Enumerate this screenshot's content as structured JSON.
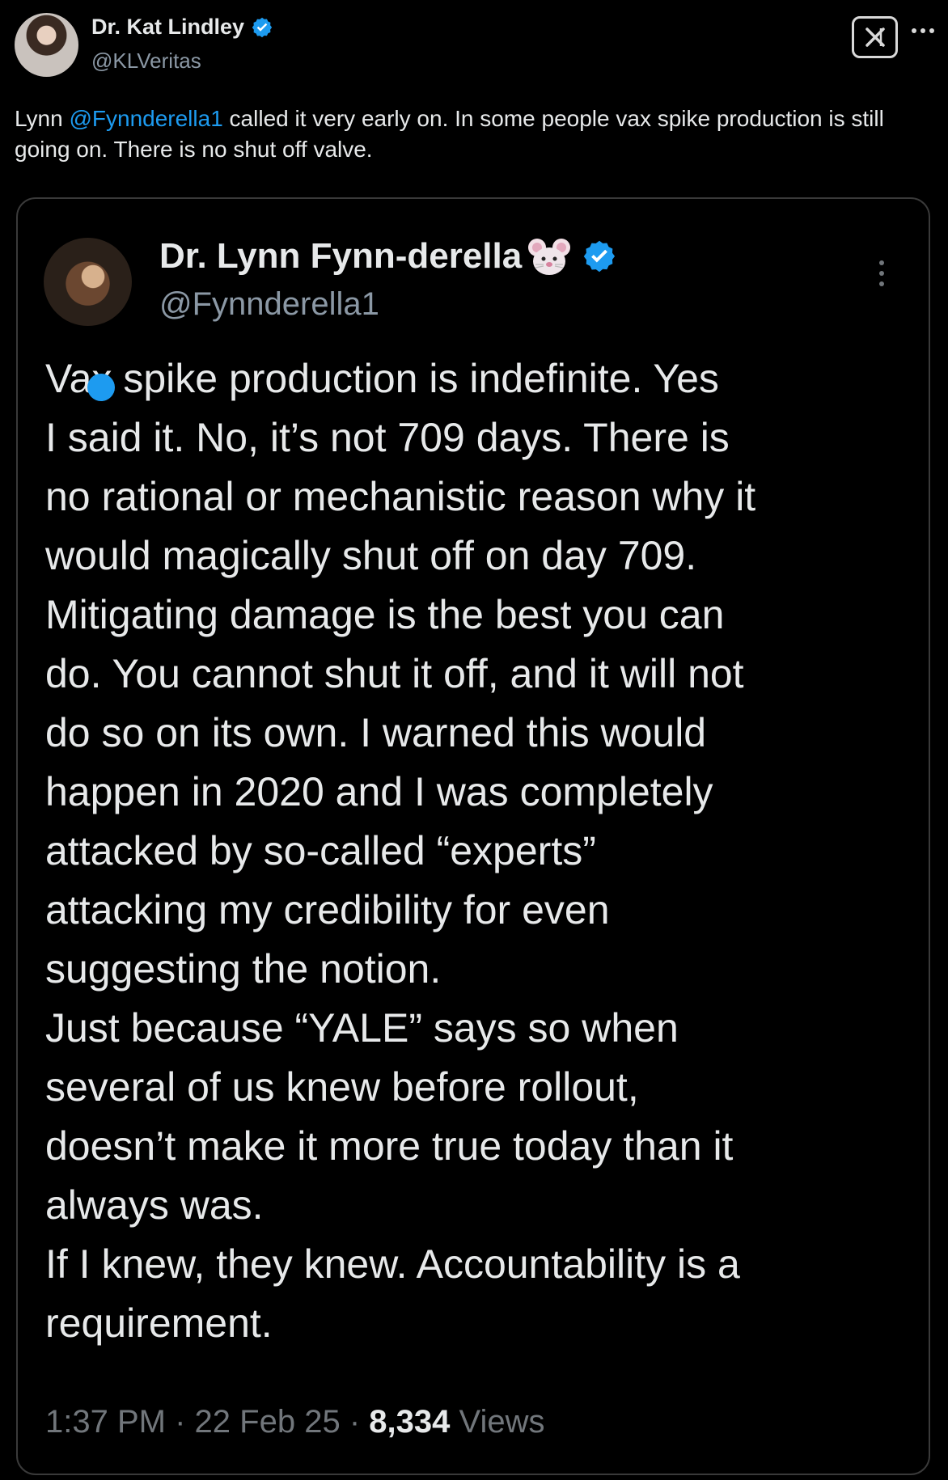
{
  "colors": {
    "background": "#000000",
    "text": "#e7e9ea",
    "muted": "#8b98a5",
    "link": "#1d9bf0",
    "border": "#3a3a3a"
  },
  "header": {
    "author_name": "Dr. Kat Lindley",
    "author_handle": "@KLVeritas",
    "icons": [
      "verified-icon",
      "x-logo-icon",
      "more-icon"
    ]
  },
  "post": {
    "text_before_mention": "Lynn ",
    "mention": "@Fynnderella1",
    "text_after_mention": " called it very early on. In some people vax spike production is still going on. There is no shut off valve."
  },
  "quoted_post": {
    "author_name": "Dr. Lynn Fynn-derella",
    "author_handle": "@Fynnderella1",
    "icons": [
      "mouse-face-icon",
      "verified-icon",
      "more-icon"
    ],
    "text": "Vax spike production is indefinite. Yes\nI said it. No, it’s not 709 days. There is\nno rational or mechanistic reason why it\nwould magically shut off on day 709.\nMitigating damage is the best you can\ndo. You cannot shut it off, and it will not\ndo so on its own. I warned this would\nhappen in 2020 and I was completely\nattacked by so-called “experts”\nattacking my credibility for even\nsuggesting the notion.\nJust because “YALE” says so when\nseveral of us knew before rollout,\ndoesn’t make it more true today than it\nalways was.\nIf I knew, they knew. Accountability is a\nrequirement.",
    "time": "1:37 PM",
    "separator": "·",
    "date": "22 Feb 25",
    "views_count": "8,334",
    "views_label": "Views"
  }
}
